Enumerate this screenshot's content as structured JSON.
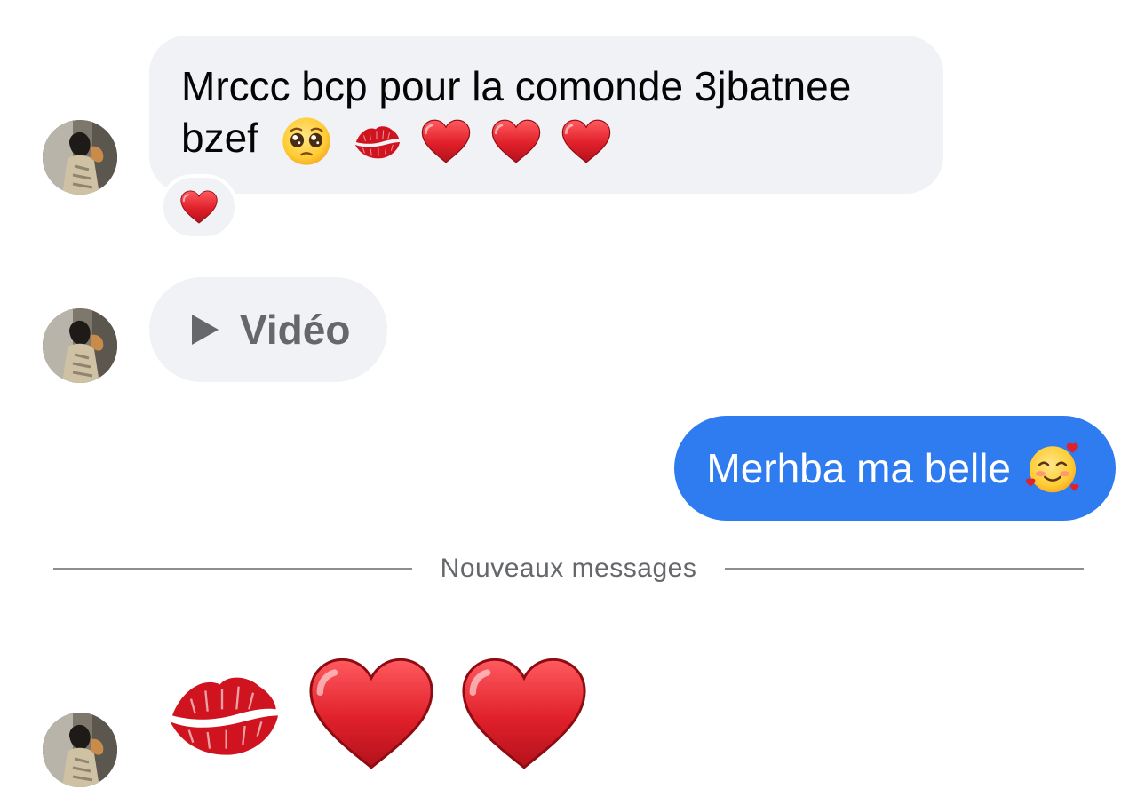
{
  "conversation": {
    "messages": [
      {
        "direction": "incoming",
        "text": "Mrccc bcp pour la comonde 3jbatnee",
        "text_line2": "bzef",
        "emojis": [
          "pleading-face-icon",
          "kiss-mark-icon",
          "red-heart-icon",
          "red-heart-icon",
          "red-heart-icon"
        ],
        "reaction": "red-heart-icon"
      },
      {
        "direction": "incoming",
        "type": "video",
        "label": "Vidéo",
        "icon": "play-icon"
      },
      {
        "direction": "outgoing",
        "text": "Merhba ma belle",
        "emoji": "smiling-face-with-hearts-icon"
      },
      {
        "direction": "incoming",
        "type": "emoji-only",
        "emojis": [
          "kiss-mark-icon",
          "red-heart-icon",
          "red-heart-icon"
        ]
      }
    ],
    "divider_label": "Nouveaux messages"
  },
  "colors": {
    "incoming_bubble": "#f0f2f5",
    "outgoing_bubble": "#2f7bf0",
    "heart": "#e0202a",
    "divider_line": "#8a8d91"
  }
}
